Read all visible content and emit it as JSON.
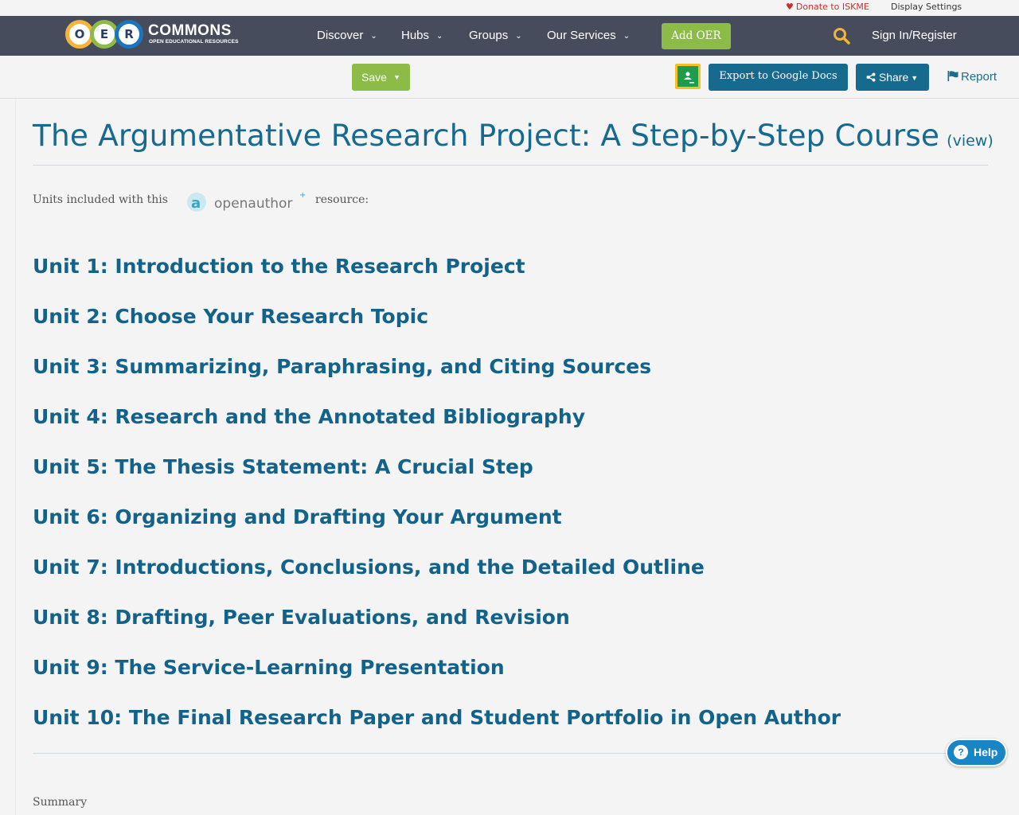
{
  "utility": {
    "donate_label": "Donate to ISKME",
    "display_settings_label": "Display Settings"
  },
  "logo": {
    "letters": [
      "O",
      "E",
      "R"
    ],
    "brand": "COMMONS",
    "subtitle": "OPEN EDUCATIONAL RESOURCES"
  },
  "nav": {
    "items": [
      {
        "label": "Discover"
      },
      {
        "label": "Hubs"
      },
      {
        "label": "Groups"
      },
      {
        "label": "Our Services"
      }
    ],
    "add_oer_label": "Add OER",
    "signin_label": "Sign In/Register"
  },
  "toolbar": {
    "save_label": "Save",
    "export_label": "Export to Google Docs",
    "share_label": "Share",
    "report_label": "Report"
  },
  "resource": {
    "title": "The Argumentative Research Project: A Step-by-Step Course",
    "view_label": "(view)",
    "units_included_pre": "Units included with this",
    "units_included_logo_text": "openauthor",
    "units_included_post": "resource:",
    "units": [
      "Unit 1: Introduction to the Research Project",
      "Unit 2: Choose Your Research Topic",
      "Unit 3: Summarizing, Paraphrasing, and Citing Sources",
      "Unit 4: Research and the Annotated Bibliography",
      "Unit 5: The Thesis Statement: A Crucial Step",
      "Unit 6: Organizing and Drafting Your Argument",
      "Unit 7: Introductions, Conclusions, and the Detailed Outline",
      "Unit 8: Drafting, Peer Evaluations, and Revision",
      "Unit 9: The Service-Learning Presentation",
      "Unit 10: The Final Research Paper and Student Portfolio in Open Author"
    ],
    "summary_label": "Summary"
  },
  "help": {
    "label": "Help"
  },
  "colors": {
    "navbar": "#464c5c",
    "accent_green": "#8dbb48",
    "accent_blue": "#166a8d",
    "link_blue": "#12628a",
    "donate_red": "#c9302c"
  },
  "icons": {
    "donate": "heart-icon",
    "search": "search-icon",
    "share": "share-icon",
    "report": "flag-icon",
    "classroom": "google-classroom-icon",
    "help": "question-icon"
  }
}
